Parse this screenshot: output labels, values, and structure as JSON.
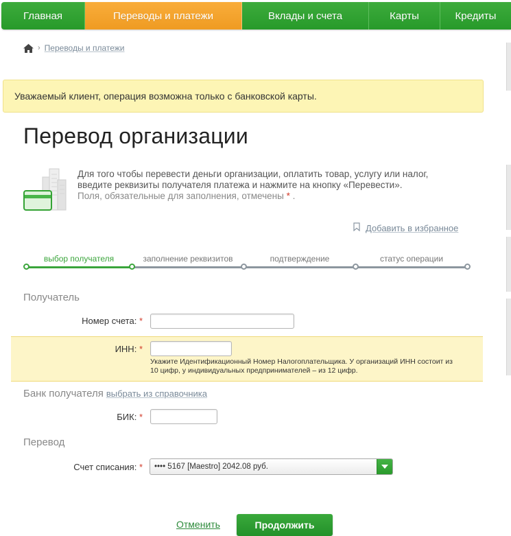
{
  "nav": {
    "items": [
      {
        "label": "Главная"
      },
      {
        "label": "Переводы и платежи"
      },
      {
        "label": "Вклады и счета"
      },
      {
        "label": "Карты"
      },
      {
        "label": "Кредиты"
      }
    ],
    "active_index": 1,
    "active_color": "#f5a52c",
    "color": "#2f9e32"
  },
  "breadcrumb": {
    "home_icon": "home-icon",
    "separator": "›",
    "current": "Переводы и платежи"
  },
  "notice": {
    "text": "Уважаемый клиент, операция возможна только с банковской карты."
  },
  "page_title": "Перевод организации",
  "description": {
    "icon": "card-buildings-icon",
    "line1": "Для того чтобы перевести деньги организации, оплатить товар, услугу или налог,",
    "line2": "введите реквизиты получателя платежа и нажмите на кнопку «Перевести».",
    "line3": "Поля, обязательные для заполнения, отмечены",
    "required_mark": "*",
    "line3_end": "."
  },
  "favorites": {
    "icon": "bookmark-icon",
    "label": "Добавить в избранное"
  },
  "stepper": {
    "steps": [
      {
        "label": "выбор получателя"
      },
      {
        "label": "заполнение реквизитов"
      },
      {
        "label": "подтверждение"
      },
      {
        "label": "статус операции"
      }
    ],
    "current_step": 1
  },
  "recipient": {
    "section_title": "Получатель",
    "account": {
      "label": "Номер счета:",
      "required": "*",
      "value": ""
    },
    "inn": {
      "label": "ИНН:",
      "required": "*",
      "value": "",
      "hint_line1": "Укажите Идентификационный Номер Налогоплательщика. У организаций ИНН состоит из",
      "hint_line2": "10 цифр, у индивидуальных предпринимателей – из 12 цифр."
    }
  },
  "bank": {
    "section_title": "Банк получателя",
    "directory_link": "выбрать из справочника",
    "bik": {
      "label": "БИК:",
      "required": "*",
      "value": ""
    }
  },
  "transfer": {
    "section_title": "Перевод",
    "debit_account": {
      "label": "Счет списания:",
      "required": "*",
      "selected": "•••• 5167 [Maestro] 2042.08 руб."
    }
  },
  "actions": {
    "cancel_label": "Отменить",
    "continue_label": "Продолжить"
  }
}
